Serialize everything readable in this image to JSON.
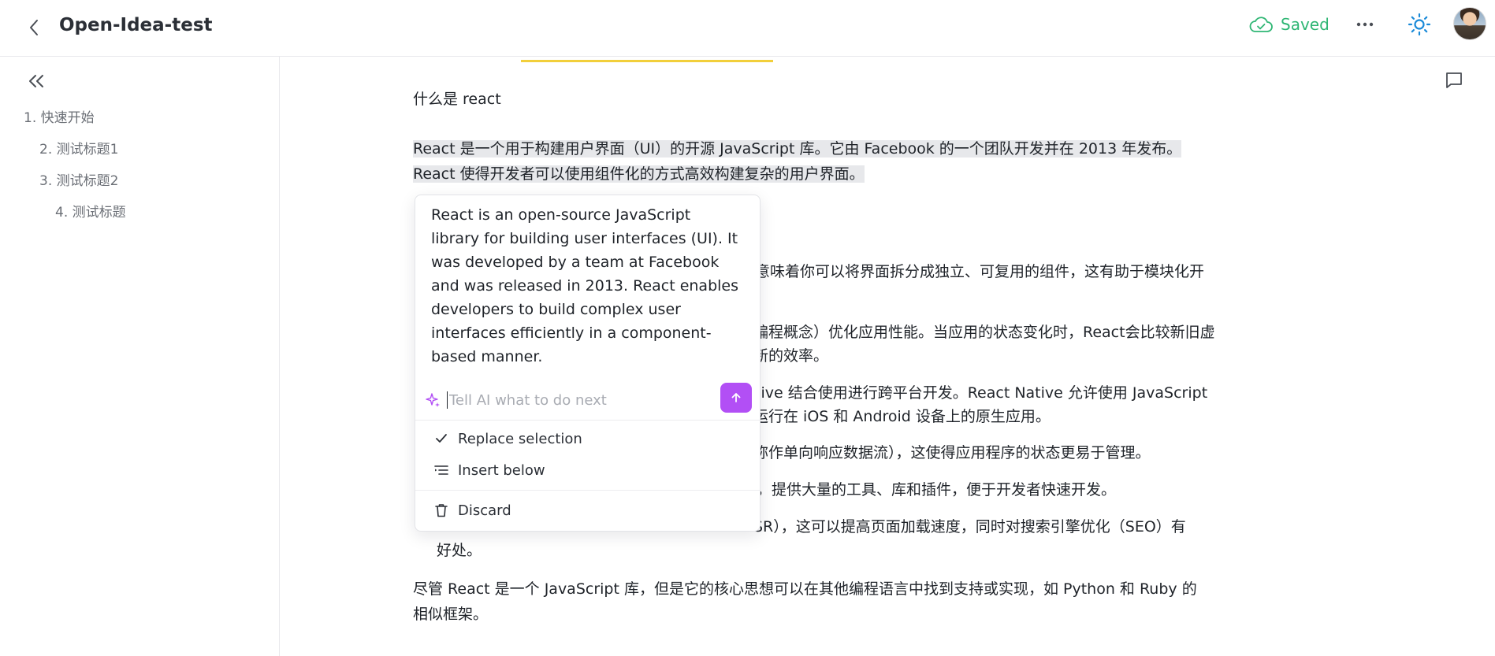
{
  "header": {
    "title": "Open-Idea-test",
    "saved_label": "Saved",
    "colors": {
      "saved": "#2fb674",
      "accent": "#1a8ad8"
    }
  },
  "sidebar": {
    "toc": [
      {
        "label": "1. 快速开始"
      },
      {
        "label": "2. 测试标题1"
      },
      {
        "label": "3. 测试标题2"
      },
      {
        "label": "4. 测试标题"
      }
    ]
  },
  "content": {
    "heading_what": "什么是 react",
    "intro_line1": "React 是一个用于构建用户界面（UI）的开源 JavaScript 库。它由 Facebook 的一个团队开发并在 2013 年发布。",
    "intro_line2": "React 使得开发者可以使用组件化的方式高效构建复杂的用户界面。",
    "frag_1": "意味着你可以将界面拆分成独立、可复用的组件，这有助于模块化开",
    "frag_2a": "编程概念）优化应用性能。当应用的状态变化时，React会比较新旧虚",
    "frag_2b": "新的效率。",
    "frag_3a": "tive 结合使用进行跨平台开发。React Native 允许使用 JavaScript",
    "frag_3b": "运行在 iOS 和 Android 设备上的原生应用。",
    "frag_4": "称作单向响应数据流），这使得应用程序的状态更易于管理。",
    "frag_5": "，提供大量的工具、库和插件，便于开发者快速开发。",
    "frag_6a": "SR），这可以提高页面加载速度，同时对搜索引擎优化（SEO）有",
    "frag_6b": "好处。",
    "outro_line1": "尽管 React 是一个 JavaScript 库，但是它的核心思想可以在其他编程语言中找到支持或实现，如 Python 和 Ruby 的",
    "outro_line2": "相似框架。"
  },
  "ai_popover": {
    "response": "React is an open-source JavaScript\nlibrary for building user interfaces (UI). It\nwas developed by a team at Facebook\nand was released in 2013. React enables\ndevelopers to build complex user\ninterfaces efficiently in a component-\nbased manner.",
    "input_placeholder": "Tell AI what to do next",
    "menu": {
      "replace": "Replace selection",
      "insert": "Insert below",
      "discard": "Discard"
    },
    "colors": {
      "send": "#b24ff5",
      "sparkle": "#b24ff5"
    }
  }
}
